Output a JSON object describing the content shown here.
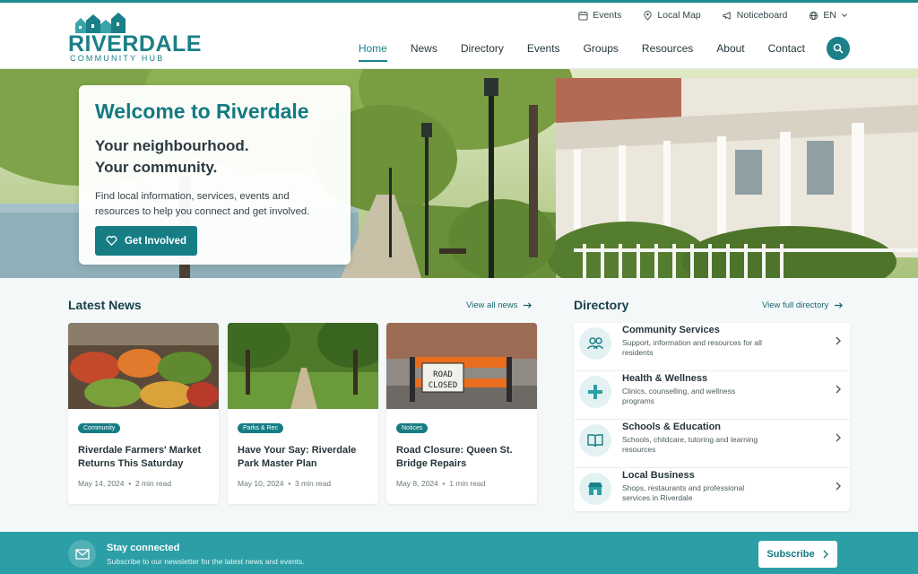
{
  "brand": {
    "name": "RIVERDALE",
    "subtitle": "COMMUNITY HUB",
    "accent": "#177d85"
  },
  "utility": {
    "events": "Events",
    "map": "Local Map",
    "noticeboard": "Noticeboard",
    "language": "EN"
  },
  "nav": {
    "items": [
      "Home",
      "News",
      "Directory",
      "Events",
      "Groups",
      "Resources",
      "About",
      "Contact"
    ],
    "active": "Home"
  },
  "hero": {
    "title": "Welcome to Riverdale",
    "tagline1": "Your neighbourhood.",
    "tagline2": "Your community.",
    "description": "Find local information, services, events and resources to help you connect and get involved.",
    "cta": "Get Involved"
  },
  "news": {
    "title": "Latest News",
    "view_all": "View all news",
    "cards": [
      {
        "tag": "Community",
        "title": "Riverdale Farmers' Market Returns This Saturday",
        "date": "May 14, 2024",
        "read": "2 min read",
        "image": "farmers-market-produce"
      },
      {
        "tag": "Parks & Rec",
        "title": "Have Your Say: Riverdale Park Master Plan",
        "date": "May 10, 2024",
        "read": "3 min read",
        "image": "park-tree-lined-path"
      },
      {
        "tag": "Notices",
        "title": "Road Closure: Queen St. Bridge Repairs",
        "date": "May 8, 2024",
        "read": "1 min read",
        "image": "road-closed-barrier",
        "sign_line1": "ROAD",
        "sign_line2": "CLOSED"
      }
    ]
  },
  "directory": {
    "title": "Directory",
    "view_all": "View full directory",
    "items": [
      {
        "title": "Community Services",
        "desc": "Support, information and resources for all residents",
        "icon": "people-icon"
      },
      {
        "title": "Health & Wellness",
        "desc": "Clinics, counselling, and wellness programs",
        "icon": "medical-cross-icon"
      },
      {
        "title": "Schools & Education",
        "desc": "Schools, childcare, tutoring and learning resources",
        "icon": "book-icon"
      },
      {
        "title": "Local Business",
        "desc": "Shops, restaurants and professional services in Riverdale",
        "icon": "storefront-icon"
      }
    ]
  },
  "newsletter": {
    "title": "Stay connected",
    "desc": "Subscribe to our newsletter for the latest news and events.",
    "button": "Subscribe"
  }
}
